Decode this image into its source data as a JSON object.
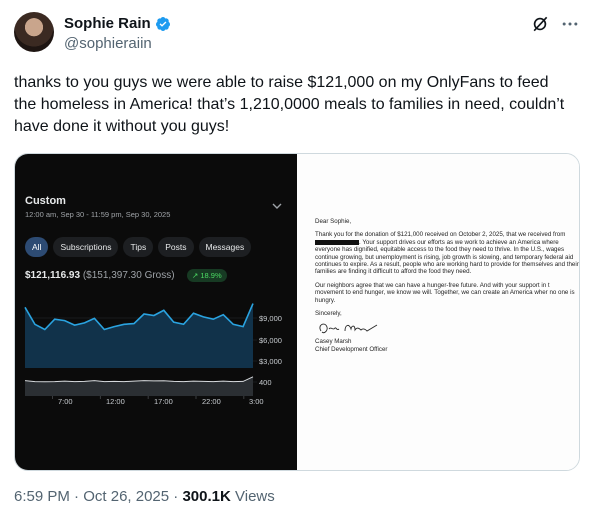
{
  "author": {
    "name": "Sophie Rain",
    "handle": "@sophieraiin",
    "verified_color": "#1d9bf0"
  },
  "icons": {
    "verified": "verified-badge-icon",
    "grok": "grok-icon",
    "more": "more-icon",
    "chevron": "chevron-down-icon",
    "trend": "trend-up-icon"
  },
  "tweet": {
    "text": "thanks to you guys we were able to raise $121,000 on my OnlyFans to feed the homeless in America! that’s 1,210,0000 meals to families in need, couldn’t have done it without you guys!"
  },
  "phone": {
    "title": "Custom",
    "subtitle": "12:00 am, Sep 30 - 11:59 pm, Sep 30, 2025",
    "tabs": [
      "All",
      "Subscriptions",
      "Tips",
      "Posts",
      "Messages"
    ],
    "active_tab": "All",
    "amount": "$121,116.93",
    "gross": "($151,397.30 Gross)",
    "badge": "18.9%",
    "accent_color": "#2aa3e0",
    "upper_y_labels": [
      "$9,000",
      "$6,000",
      "$3,000"
    ],
    "lower_y_labels": [
      "400",
      "200"
    ],
    "x_labels": [
      "7:00",
      "12:00",
      "17:00",
      "22:00",
      "3:00"
    ]
  },
  "chart_data": [
    {
      "type": "area",
      "title": "",
      "xlabel": "",
      "ylabel": "",
      "ylim": [
        0,
        10000
      ],
      "y_ticks": [
        "$9,000",
        "$6,000",
        "$3,000"
      ],
      "x": [
        0,
        1,
        2,
        3,
        4,
        5,
        6,
        7,
        8,
        9,
        10,
        11,
        12,
        13,
        14,
        15,
        16,
        17,
        18,
        19,
        20,
        21,
        22,
        23
      ],
      "values": [
        8200,
        5900,
        5200,
        6600,
        6400,
        5800,
        6100,
        6700,
        5200,
        5600,
        5900,
        6000,
        7300,
        7100,
        7800,
        6200,
        5900,
        7400,
        6900,
        6600,
        7200,
        5900,
        5600,
        8700
      ]
    },
    {
      "type": "area",
      "title": "",
      "xlabel": "",
      "ylabel": "",
      "ylim": [
        0,
        500
      ],
      "y_ticks": [
        "400",
        "200"
      ],
      "x_tick_labels": [
        "7:00",
        "12:00",
        "17:00",
        "22:00",
        "3:00"
      ],
      "x": [
        0,
        1,
        2,
        3,
        4,
        5,
        6,
        7,
        8,
        9,
        10,
        11,
        12,
        13,
        14,
        15,
        16,
        17,
        18,
        19,
        20,
        21,
        22,
        23
      ],
      "values": [
        320,
        300,
        295,
        300,
        310,
        300,
        305,
        320,
        300,
        305,
        300,
        310,
        320,
        315,
        318,
        305,
        300,
        310,
        305,
        300,
        310,
        300,
        305,
        400
      ]
    }
  ],
  "letter": {
    "salutation": "Dear Sophie,",
    "para1_a": "Thank you for the donation of $121,000 received on October 2, 2025, that we received from",
    "para1_b": "Your support drives our efforts as we work to achieve an America where everyone has dignified, equitable access to the food they need to thrive. In the U.S., wages continue growing, but unemployment is rising, job growth is slowing, and temporary federal aid continues to expire. As a result, people who are working hard to provide for themselves and their families are finding it difficult to afford the food they need.",
    "para2": "Our neighbors agree that we can have a hunger-free future. And with your support in t movement to end hunger, we know we will. Together, we can create an America wher no one is hungry.",
    "closing": "Sincerely,",
    "signer_name": "Casey Marsh",
    "signer_title": "Chief Development Officer"
  },
  "meta": {
    "time": "6:59 PM",
    "date": "Oct 26, 2025",
    "views_count": "300.1K",
    "views_label": "Views"
  }
}
